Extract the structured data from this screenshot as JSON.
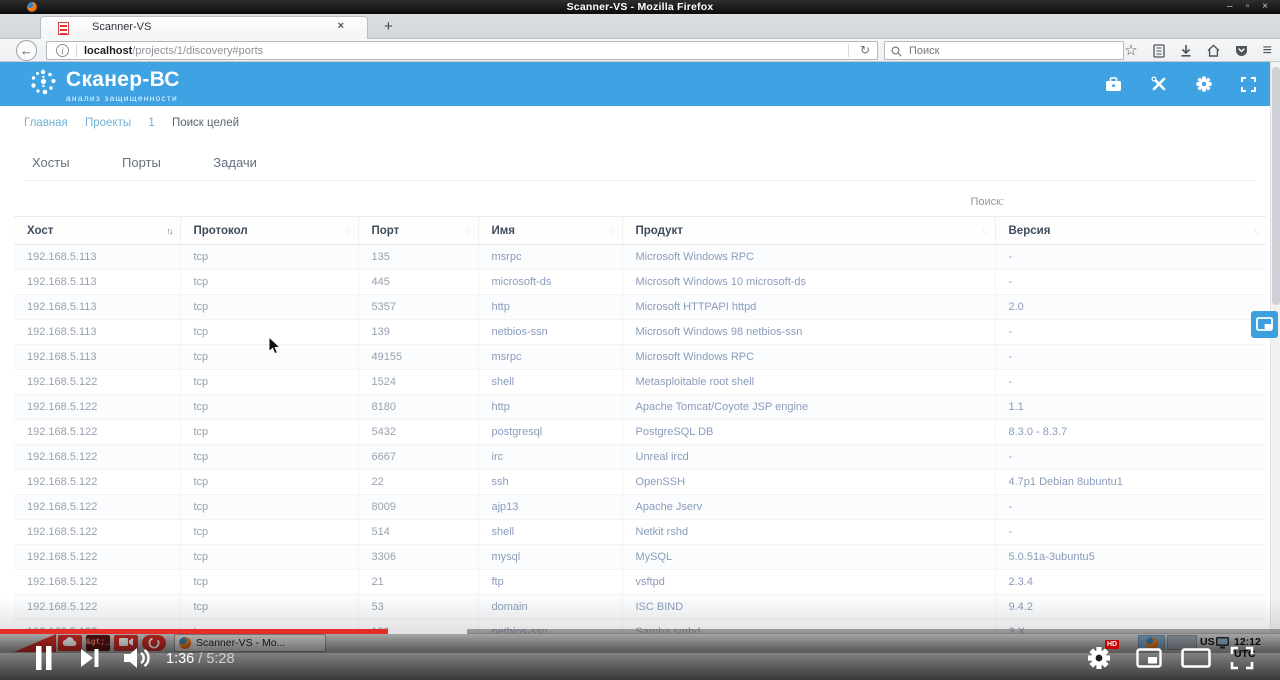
{
  "window": {
    "title": "Scanner-VS - Mozilla Firefox",
    "minimize_glyph": "–",
    "maximize_glyph": "▫",
    "close_glyph": "×"
  },
  "browser": {
    "tab_title": "Scanner-VS",
    "tab_close_glyph": "×",
    "new_tab_glyph": "+",
    "url_host": "localhost",
    "url_path": "/projects/1/discovery#ports",
    "reload_glyph": "↻",
    "search_placeholder": "Поиск",
    "star_glyph": "☆",
    "menu_glyph": "≡",
    "toolbar_icons": [
      "bookmark-star",
      "library",
      "download",
      "home",
      "pocket",
      "menu"
    ]
  },
  "app_header": {
    "brand": "Сканер-ВС",
    "tagline": "анализ защищенности",
    "icons": [
      "briefcase",
      "tools",
      "settings-gear",
      "fullscreen-expand"
    ],
    "color": "#3fa2e3"
  },
  "breadcrumb": {
    "items": [
      "Главная",
      "Проекты",
      "1",
      "Поиск целей"
    ]
  },
  "nav_tabs": [
    {
      "label": "Хосты"
    },
    {
      "label": "Порты"
    },
    {
      "label": "Задачи"
    }
  ],
  "search": {
    "label": "Поиск:",
    "value": ""
  },
  "table": {
    "sort_glyph": "↑↓",
    "keys": [
      "host",
      "protocol",
      "port",
      "name",
      "product",
      "version"
    ],
    "columns": [
      "Хост",
      "Протокол",
      "Порт",
      "Имя",
      "Продукт",
      "Версия"
    ],
    "rows": [
      [
        "192.168.5.113",
        "tcp",
        "135",
        "msrpc",
        "Microsoft Windows RPC",
        "-"
      ],
      [
        "192.168.5.113",
        "tcp",
        "445",
        "microsoft-ds",
        "Microsoft Windows 10 microsoft-ds",
        "-"
      ],
      [
        "192.168.5.113",
        "tcp",
        "5357",
        "http",
        "Microsoft HTTPAPI httpd",
        "2.0"
      ],
      [
        "192.168.5.113",
        "tcp",
        "139",
        "netbios-ssn",
        "Microsoft Windows 98 netbios-ssn",
        "-"
      ],
      [
        "192.168.5.113",
        "tcp",
        "49155",
        "msrpc",
        "Microsoft Windows RPC",
        "-"
      ],
      [
        "192.168.5.122",
        "tcp",
        "1524",
        "shell",
        "Metasploitable root shell",
        "-"
      ],
      [
        "192.168.5.122",
        "tcp",
        "8180",
        "http",
        "Apache Tomcat/Coyote JSP engine",
        "1.1"
      ],
      [
        "192.168.5.122",
        "tcp",
        "5432",
        "postgresql",
        "PostgreSQL DB",
        "8.3.0 - 8.3.7"
      ],
      [
        "192.168.5.122",
        "tcp",
        "6667",
        "irc",
        "Unreal ircd",
        "-"
      ],
      [
        "192.168.5.122",
        "tcp",
        "22",
        "ssh",
        "OpenSSH",
        "4.7p1 Debian 8ubuntu1"
      ],
      [
        "192.168.5.122",
        "tcp",
        "8009",
        "ajp13",
        "Apache Jserv",
        "-"
      ],
      [
        "192.168.5.122",
        "tcp",
        "514",
        "shell",
        "Netkit rshd",
        "-"
      ],
      [
        "192.168.5.122",
        "tcp",
        "3306",
        "mysql",
        "MySQL",
        "5.0.51a-3ubuntu5"
      ],
      [
        "192.168.5.122",
        "tcp",
        "21",
        "ftp",
        "vsftpd",
        "2.3.4"
      ],
      [
        "192.168.5.122",
        "tcp",
        "53",
        "domain",
        "ISC BIND",
        "9.4.2"
      ],
      [
        "192.168.5.122",
        "tcp",
        "139",
        "netbios-ssn",
        "Samba smbd",
        "3.X"
      ]
    ]
  },
  "floating_panel_button": {
    "icon": "picture-in-picture"
  },
  "player": {
    "time_current": "1:36",
    "time_rest": " / 5:28",
    "hd_badge": "HD",
    "progress_color": "#e52d27",
    "controls": [
      "pause",
      "next",
      "volume",
      "settings",
      "miniplayer",
      "theater",
      "fullscreen"
    ]
  },
  "desktop_taskbar": {
    "window_button": "Scanner-VS - Mo...",
    "terminal_glyph": "&gt;_",
    "keyboard_layout": "US",
    "clock": "12:12 UTC"
  }
}
